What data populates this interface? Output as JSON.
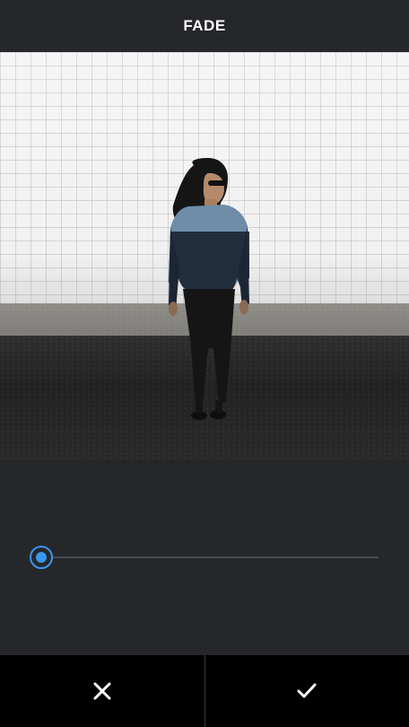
{
  "header": {
    "title": "FADE"
  },
  "photo": {
    "icon": "photo-preview"
  },
  "fade_slider": {
    "value": 0,
    "accent_color": "#3897f0"
  },
  "actions": {
    "cancel_icon": "close-icon",
    "confirm_icon": "checkmark-icon"
  },
  "colors": {
    "background": "#26272b",
    "action_bar": "#000000",
    "accent": "#3897f0"
  }
}
